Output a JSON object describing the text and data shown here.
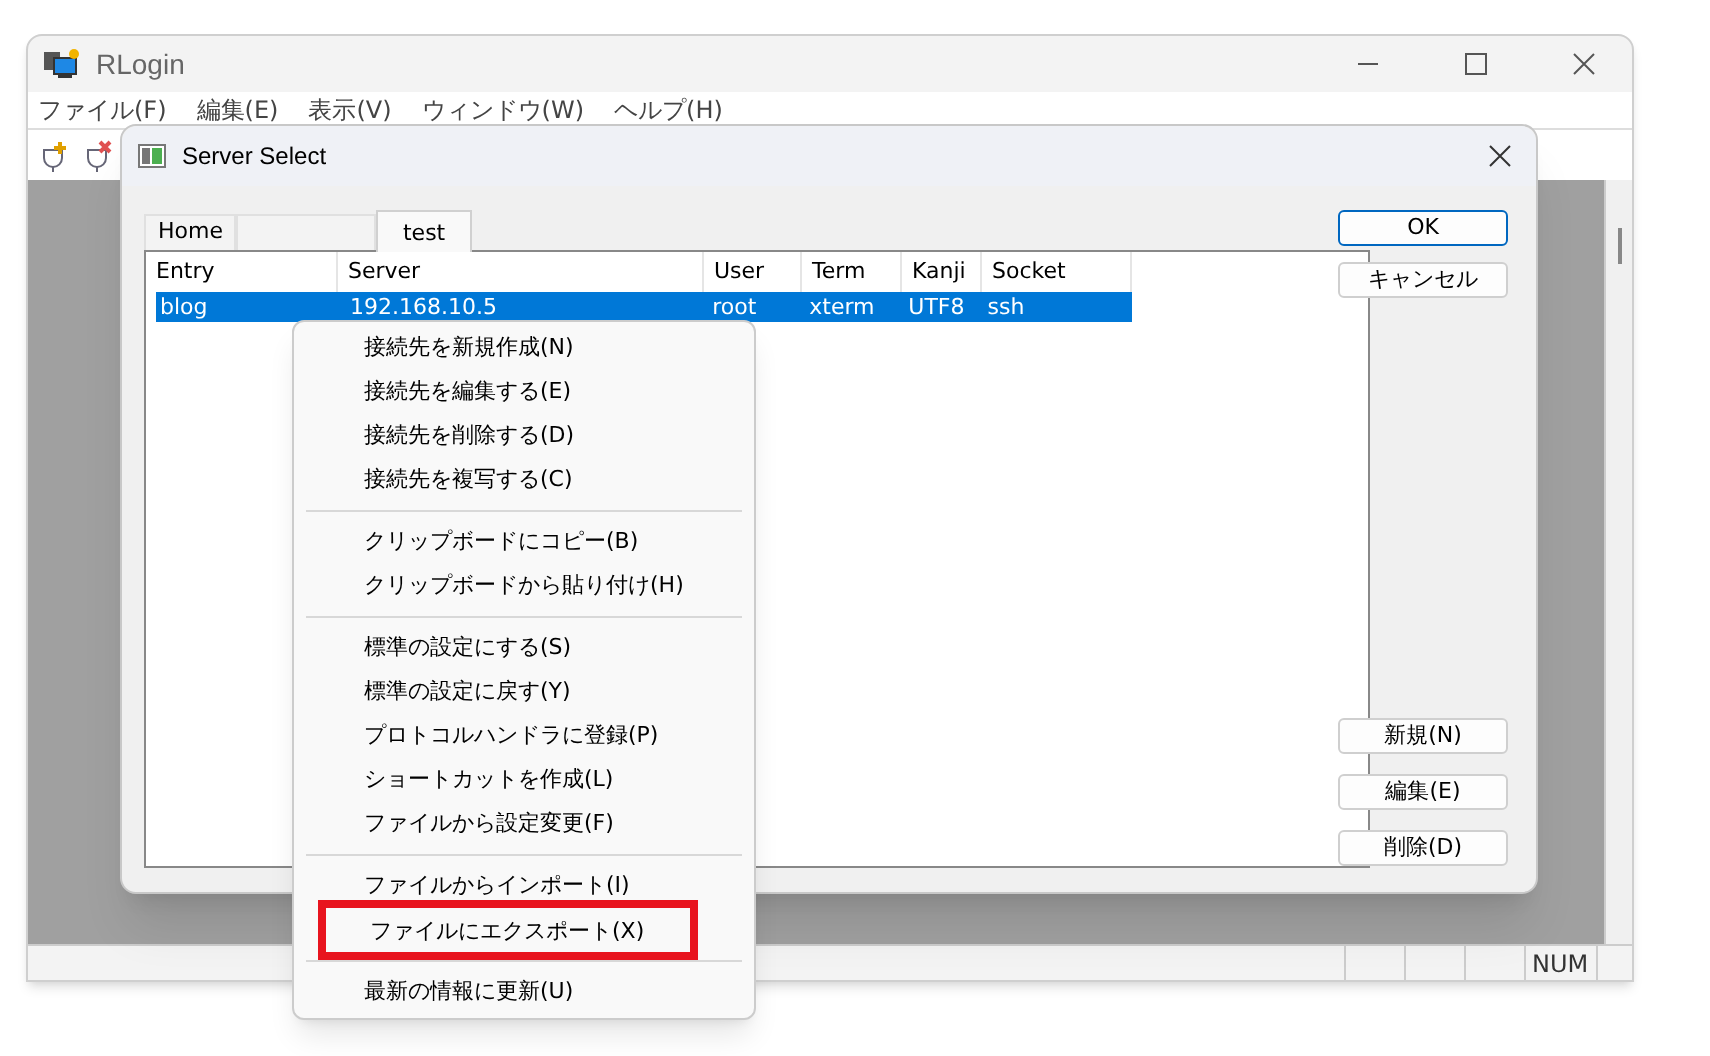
{
  "window": {
    "title": "RLogin"
  },
  "menu_bar": [
    "ファイル(F)",
    "編集(E)",
    "表示(V)",
    "ウィンドウ(W)",
    "ヘルプ(H)"
  ],
  "status_bar": {
    "indicator": "NUM"
  },
  "dialog": {
    "title": "Server Select",
    "tabs": [
      {
        "label": "Home",
        "selected": false
      },
      {
        "selected": false
      },
      {
        "label": "test",
        "selected": true
      }
    ],
    "table": {
      "columns": [
        "Entry",
        "Server",
        "User",
        "Term",
        "Kanji",
        "Socket"
      ],
      "rows": [
        {
          "cells": [
            "blog",
            "192.168.10.5",
            "root",
            "xterm",
            "UTF8",
            "ssh"
          ],
          "selected": true
        }
      ]
    },
    "buttons_top": [
      {
        "label": "OK",
        "default": true
      },
      {
        "label": "キャンセル",
        "default": false
      }
    ],
    "buttons_bottom": [
      {
        "label": "新規(N)"
      },
      {
        "label": "編集(E)"
      },
      {
        "label": "削除(D)"
      }
    ]
  },
  "context_menu": [
    {
      "kind": "item",
      "label": "接続先を新規作成(N)",
      "marked": false
    },
    {
      "kind": "item",
      "label": "接続先を編集する(E)",
      "marked": false
    },
    {
      "kind": "item",
      "label": "接続先を削除する(D)",
      "marked": false
    },
    {
      "kind": "item",
      "label": "接続先を複写する(C)",
      "marked": false
    },
    {
      "kind": "separator"
    },
    {
      "kind": "item",
      "label": "クリップボードにコピー(B)",
      "marked": false
    },
    {
      "kind": "item",
      "label": "クリップボードから貼り付け(H)",
      "marked": false
    },
    {
      "kind": "separator"
    },
    {
      "kind": "item",
      "label": "標準の設定にする(S)",
      "marked": false
    },
    {
      "kind": "item",
      "label": "標準の設定に戻す(Y)",
      "marked": false
    },
    {
      "kind": "item",
      "label": "プロトコルハンドラに登録(P)",
      "marked": false
    },
    {
      "kind": "item",
      "label": "ショートカットを作成(L)",
      "marked": false
    },
    {
      "kind": "item",
      "label": "ファイルから設定変更(F)",
      "marked": false
    },
    {
      "kind": "separator"
    },
    {
      "kind": "item",
      "label": "ファイルからインポート(I)",
      "marked": false
    },
    {
      "kind": "item",
      "label": "ファイルにエクスポート(X)",
      "marked": true
    },
    {
      "kind": "separator"
    },
    {
      "kind": "item",
      "label": "最新の情報に更新(U)",
      "marked": false
    }
  ]
}
